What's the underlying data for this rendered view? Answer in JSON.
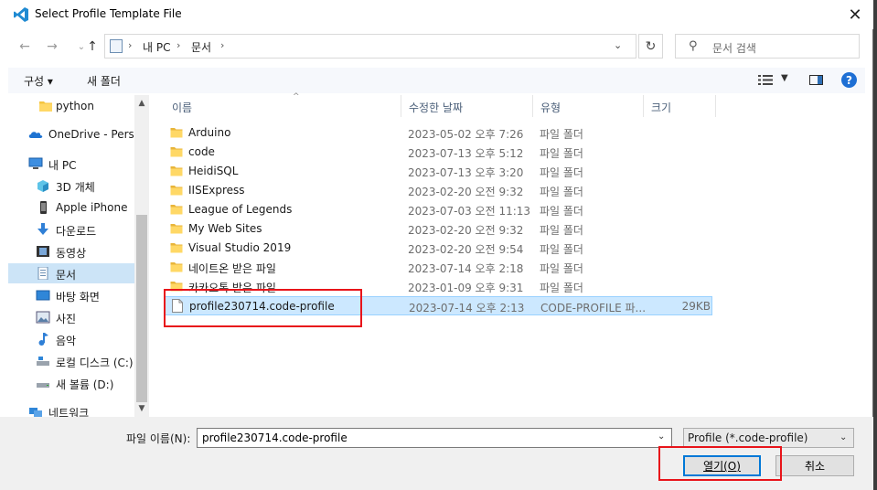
{
  "window": {
    "title": "Select Profile Template File",
    "close_glyph": "✕"
  },
  "nav_buttons": {
    "back": "←",
    "forward": "→",
    "up": "↑"
  },
  "address": {
    "crumbs": [
      "내 PC",
      "문서"
    ],
    "sep": "›",
    "dropdown": "⌄",
    "refresh": "↻"
  },
  "search": {
    "placeholder": "문서 검색"
  },
  "toolbar": {
    "organize": "구성 ▾",
    "new_folder": "새 폴더",
    "help": "?"
  },
  "sidebar": {
    "items": [
      {
        "label": "python",
        "icon": "folder-icon",
        "selected": false
      },
      {
        "label": "OneDrive - Person",
        "icon": "cloud-icon",
        "selected": false
      },
      {
        "label": "내 PC",
        "icon": "pc-icon",
        "selected": false
      },
      {
        "label": "3D 개체",
        "icon": "cube-icon",
        "selected": false
      },
      {
        "label": "Apple iPhone",
        "icon": "phone-icon",
        "selected": false
      },
      {
        "label": "다운로드",
        "icon": "download-icon",
        "selected": false
      },
      {
        "label": "동영상",
        "icon": "video-icon",
        "selected": false
      },
      {
        "label": "문서",
        "icon": "document-icon",
        "selected": true
      },
      {
        "label": "바탕 화면",
        "icon": "desktop-icon",
        "selected": false
      },
      {
        "label": "사진",
        "icon": "picture-icon",
        "selected": false
      },
      {
        "label": "음악",
        "icon": "music-icon",
        "selected": false
      },
      {
        "label": "로컬 디스크 (C:)",
        "icon": "disk-icon",
        "selected": false
      },
      {
        "label": "새 볼륨 (D:)",
        "icon": "disk-icon",
        "selected": false
      },
      {
        "label": "네트워크",
        "icon": "network-icon",
        "selected": false
      }
    ]
  },
  "columns": {
    "name": "이름",
    "modified": "수정한 날짜",
    "type": "유형",
    "size": "크기"
  },
  "files": [
    {
      "name": "Arduino",
      "modified": "2023-05-02 오후 7:26",
      "type": "파일 폴더",
      "size": "",
      "kind": "folder"
    },
    {
      "name": "code",
      "modified": "2023-07-13 오후 5:12",
      "type": "파일 폴더",
      "size": "",
      "kind": "folder"
    },
    {
      "name": "HeidiSQL",
      "modified": "2023-07-13 오후 3:20",
      "type": "파일 폴더",
      "size": "",
      "kind": "folder"
    },
    {
      "name": "IISExpress",
      "modified": "2023-02-20 오전 9:32",
      "type": "파일 폴더",
      "size": "",
      "kind": "folder"
    },
    {
      "name": "League of Legends",
      "modified": "2023-07-03 오전 11:13",
      "type": "파일 폴더",
      "size": "",
      "kind": "folder"
    },
    {
      "name": "My Web Sites",
      "modified": "2023-02-20 오전 9:32",
      "type": "파일 폴더",
      "size": "",
      "kind": "folder"
    },
    {
      "name": "Visual Studio 2019",
      "modified": "2023-02-20 오전 9:54",
      "type": "파일 폴더",
      "size": "",
      "kind": "folder"
    },
    {
      "name": "네이트온 받은 파일",
      "modified": "2023-07-14 오후 2:18",
      "type": "파일 폴더",
      "size": "",
      "kind": "folder"
    },
    {
      "name": "카카오톡 받은 파일",
      "modified": "2023-01-09 오후 9:31",
      "type": "파일 폴더",
      "size": "",
      "kind": "folder"
    },
    {
      "name": "profile230714.code-profile",
      "modified": "2023-07-14 오후 2:13",
      "type": "CODE-PROFILE 파...",
      "size": "29KB",
      "kind": "file",
      "selected": true
    }
  ],
  "bottom": {
    "filename_label": "파일 이름(N):",
    "filename_value": "profile230714.code-profile",
    "filter_value": "Profile (*.code-profile)",
    "open_label": "열기(O)",
    "cancel_label": "취소"
  },
  "colors": {
    "accent": "#0078d7",
    "selection": "#cce8ff",
    "annotation": "#e8141a",
    "folder": "#f4c542"
  }
}
